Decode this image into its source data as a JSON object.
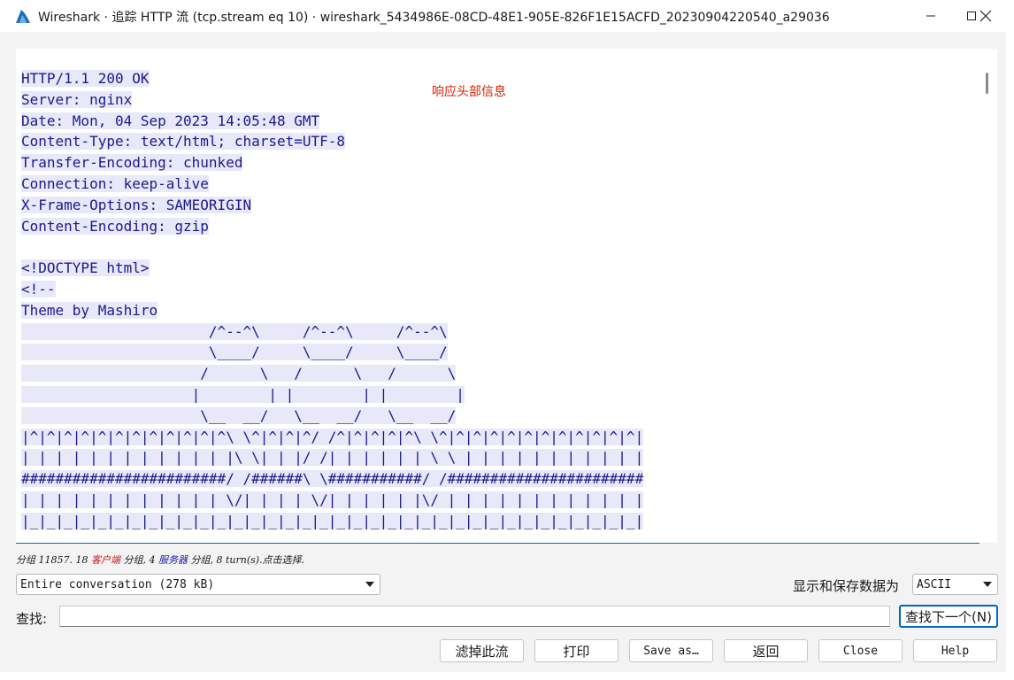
{
  "window": {
    "title": "Wireshark · 追踪 HTTP 流 (tcp.stream eq 10) · wireshark_5434986E-08CD-48E1-905E-826F1E15ACFD_20230904220540_a29036",
    "minimize_icon": "minimize-icon",
    "maximize_icon": "maximize-icon",
    "close_icon": "close-icon"
  },
  "stream": {
    "lines": [
      "HTTP/1.1 200 OK",
      "Server: nginx",
      "Date: Mon, 04 Sep 2023 14:05:48 GMT",
      "Content-Type: text/html; charset=UTF-8",
      "Transfer-Encoding: chunked",
      "Connection: keep-alive",
      "X-Frame-Options: SAMEORIGIN",
      "Content-Encoding: gzip",
      "",
      "<!DOCTYPE html>",
      "<!--",
      "Theme by Mashiro",
      "                      /^--^\\     /^--^\\     /^--^\\",
      "                      \\____/     \\____/     \\____/",
      "                     /      \\   /      \\   /      \\",
      "                    |        | |        | |        |",
      "                     \\__  __/   \\__  __/   \\__  __/",
      "|^|^|^|^|^|^|^|^|^|^|^|^\\ \\^|^|^|^/ /^|^|^|^|^\\ \\^|^|^|^|^|^|^|^|^|^|^|^|",
      "| | | | | | | | | | | | |\\ \\| | |/ /| | | | | | \\ \\ | | | | | | | | | | |",
      "########################/ /######\\ \\###########/ /#######################",
      "| | | | | | | | | | | | \\/| | | | \\/| | | | | |\\/ | | | | | | | | | | | |",
      "|_|_|_|_|_|_|_|_|_|_|_|_|_|_|_|_|_|_|_|_|_|_|_|_|_|_|_|_|_|_|_|_|_|_|_|_|"
    ],
    "annotation": "响应头部信息"
  },
  "status": {
    "prefix": "分组 11857. 18 ",
    "client": "客户端",
    "mid": " 分组, 4 ",
    "server": "服务器",
    "suffix": " 分组, 8 turn(s).点击选择."
  },
  "conversation": {
    "selected": "Entire conversation (278 kB)"
  },
  "format": {
    "label": "显示和保存数据为",
    "selected": "ASCII"
  },
  "find": {
    "label": "查找:",
    "value": "",
    "next_button": "查找下一个(N)"
  },
  "buttons": {
    "filter_out": "滤掉此流",
    "print": "打印",
    "save_as": "Save as…",
    "back": "返回",
    "close": "Close",
    "help": "Help"
  }
}
